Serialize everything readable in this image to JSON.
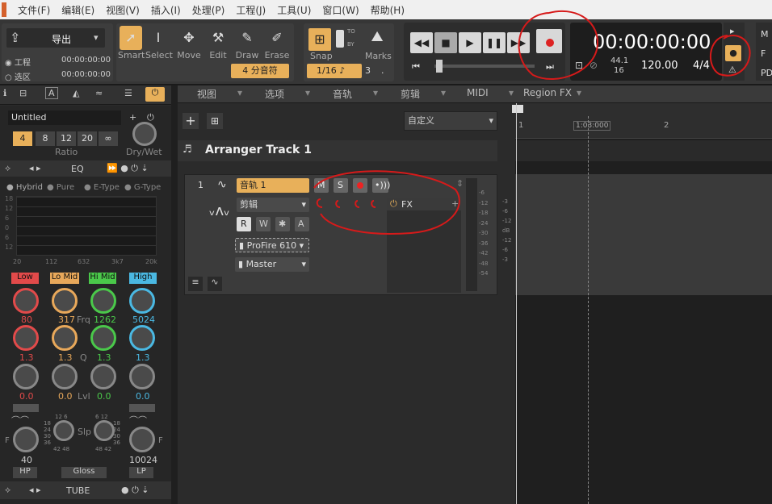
{
  "menu": [
    "文件(F)",
    "编辑(E)",
    "视图(V)",
    "插入(I)",
    "处理(P)",
    "工程(J)",
    "工具(U)",
    "窗口(W)",
    "帮助(H)"
  ],
  "toolbar": {
    "export_label": "导出",
    "project_label": "工程",
    "project_time": "00:00:00:00",
    "selection_label": "选区",
    "selection_time": "00:00:00:00",
    "tools": [
      "Smart",
      "Select",
      "Move",
      "Edit",
      "Draw",
      "Erase"
    ],
    "note_value": "4 分音符",
    "snap_label": "Snap",
    "snap_value": "1/16",
    "snap_count": "3",
    "marks_label": "Marks",
    "to_label": "TO",
    "by_label": "BY"
  },
  "transport": {
    "time": "00:00:00:00",
    "sample_rate": "44.1",
    "bit_depth": "16",
    "tempo": "120.00",
    "signature": "4/4"
  },
  "right_panel": {
    "m": "M",
    "f": "F",
    "pd": "PD"
  },
  "left": {
    "preset_name": "Untitled",
    "ratio_values": [
      "4",
      "8",
      "12",
      "20",
      "∞"
    ],
    "ratio_label": "Ratio",
    "drywet_label": "Dry/Wet",
    "eq_label": "EQ",
    "eq_modes": [
      "Hybrid",
      "Pure",
      "E-Type",
      "G-Type"
    ],
    "eq_yticks": [
      "18",
      "12",
      "6",
      "0",
      "6",
      "12",
      "18"
    ],
    "eq_xticks": [
      "20",
      "112",
      "632",
      "3k7",
      "20k"
    ],
    "bands": [
      {
        "label": "Low",
        "color": "#e24a4a",
        "frq": "80",
        "q": "1.3",
        "lvl": "0.0"
      },
      {
        "label": "Lo Mid",
        "color": "#e8a85a",
        "frq": "317",
        "q": "1.3",
        "lvl": "0.0"
      },
      {
        "label": "Hi Mid",
        "color": "#4ac84a",
        "frq": "1262",
        "q": "1.3",
        "lvl": "0.0"
      },
      {
        "label": "High",
        "color": "#4ab8e2",
        "frq": "5024",
        "q": "1.3",
        "lvl": "0.0"
      }
    ],
    "frq_label": "Frq",
    "q_label": "Q",
    "lvl_label": "Lvl",
    "slp_label": "Slp",
    "hp_value": "40",
    "lp_value": "10024",
    "hp_label": "HP",
    "lp_label": "LP",
    "gloss_label": "Gloss",
    "slope_ticks_left": [
      "12",
      "6",
      "18",
      "24",
      "30",
      "36",
      "42",
      "48"
    ],
    "slope_ticks_right": [
      "6",
      "12",
      "18",
      "24",
      "30",
      "36",
      "48",
      "42"
    ],
    "f_label": "F",
    "tube_label": "TUBE"
  },
  "main_tabs": [
    "视图",
    "选项",
    "音轨",
    "剪辑",
    "MIDI",
    "Region FX"
  ],
  "custom_label": "自定义",
  "arranger_title": "Arranger Track 1",
  "track": {
    "number": "1",
    "name": "音轨 1",
    "clip_label": "剪辑",
    "buttons": [
      "M",
      "S"
    ],
    "rwsa": [
      "R",
      "W",
      "✱",
      "A"
    ],
    "input": "ProFire 610",
    "output": "Master",
    "fx_label": "FX"
  },
  "meter_left": [
    "-6",
    "-12",
    "-18",
    "-24",
    "-30",
    "-36",
    "-42",
    "-48",
    "-54"
  ],
  "meter_right": [
    "-3",
    "-6",
    "-12",
    "dB",
    "-12",
    "-6",
    "-3"
  ],
  "ruler": [
    "1",
    "1:03:000",
    "2"
  ]
}
